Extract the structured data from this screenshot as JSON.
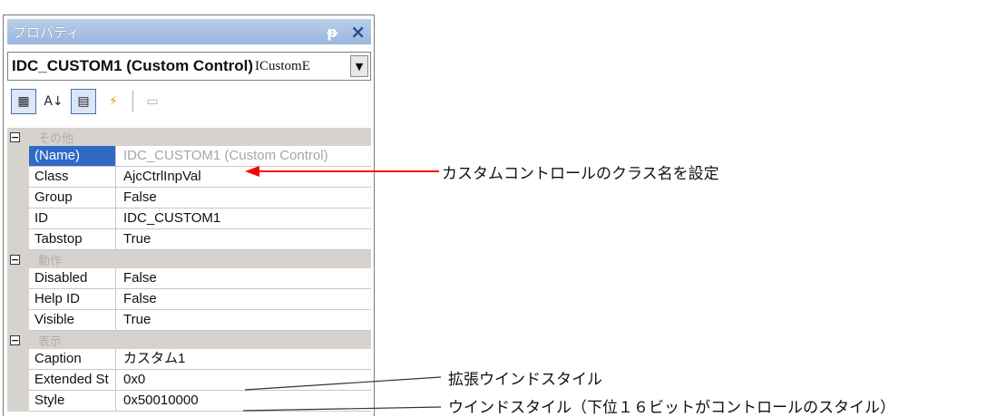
{
  "panel": {
    "title": "プロパティ",
    "pin_glyph": "ᵽ",
    "close_glyph": "×",
    "object_name": "IDC_CUSTOM1 (Custom Control)",
    "object_type": "ICustomE",
    "dropdown_glyph": "▼"
  },
  "toolbar": {
    "categorized_glyph": "▦",
    "alphabetical_glyph": "A↓",
    "properties_glyph": "▤",
    "events_glyph": "⚡",
    "pages_glyph": "▭"
  },
  "grid": {
    "categories": [
      {
        "label": "その他",
        "toggle": "−"
      },
      {
        "label": "動作",
        "toggle": "−"
      },
      {
        "label": "表示",
        "toggle": "−"
      }
    ],
    "misc": [
      {
        "name": "(Name)",
        "value": "IDC_CUSTOM1 (Custom Control)"
      },
      {
        "name": "Class",
        "value": "AjcCtrlInpVal"
      },
      {
        "name": "Group",
        "value": "False"
      },
      {
        "name": "ID",
        "value": "IDC_CUSTOM1"
      },
      {
        "name": "Tabstop",
        "value": "True"
      }
    ],
    "behavior": [
      {
        "name": "Disabled",
        "value": "False"
      },
      {
        "name": "Help ID",
        "value": "False"
      },
      {
        "name": "Visible",
        "value": "True"
      }
    ],
    "appearance": [
      {
        "name": "Caption",
        "value": "カスタム1"
      },
      {
        "name": "Extended St",
        "value": "0x0"
      },
      {
        "name": "Style",
        "value": "0x50010000"
      }
    ]
  },
  "callouts": {
    "class_note": "カスタムコントロールのクラス名を設定",
    "extended_note": "拡張ウインドスタイル",
    "style_note": "ウインドスタイル（下位１６ビットがコントロールのスタイル）",
    "arrow_color": "#ff0000"
  }
}
